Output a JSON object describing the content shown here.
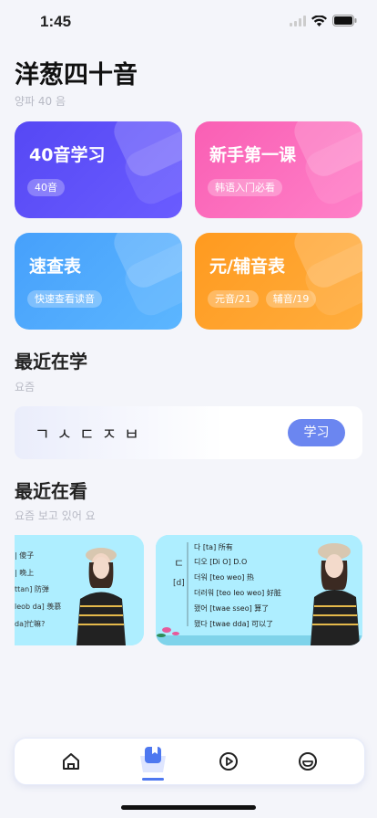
{
  "status": {
    "time": "1:45"
  },
  "header": {
    "title": "洋葱四十音",
    "subtitle": "양파 40 음"
  },
  "cards": [
    {
      "title": "40音学习",
      "tags": [
        "40音"
      ],
      "color": "#5a4bf5"
    },
    {
      "title": "新手第一课",
      "tags": [
        "韩语入门必看"
      ],
      "color": "#fb6bbd"
    },
    {
      "title": "速查表",
      "tags": [
        "快速查看读音"
      ],
      "color": "#4ea9ff"
    },
    {
      "title": "元/辅音表",
      "tags": [
        "元音/21",
        "辅音/19"
      ],
      "color": "#ffa12c"
    }
  ],
  "recent_learn": {
    "title": "最近在学",
    "subtitle": "요즘",
    "letters": "ㄱㅅㄷㅈㅂ",
    "button": "学习"
  },
  "recent_watch": {
    "title": "最近在看",
    "subtitle": "요즘 보고 있어 요",
    "videos": [
      {
        "lines": [
          "| 傻子",
          "| 晚上",
          "ttan] 防弹",
          "leob da] 羡慕",
          "da]忙嘛?"
        ]
      },
      {
        "side_char": "ㄷ",
        "side_ipa": "[d]",
        "lines": [
          "다 [ta] 所有",
          "디오 [Di O] D.O",
          "더워 [teo weo] 热",
          "더러워 [teo leo weo] 好脏",
          "됐어 [twae sseo] 算了",
          "됐다 [twae dda] 可以了"
        ]
      }
    ]
  },
  "tabbar": {
    "items": [
      "home-icon",
      "book-icon",
      "play-icon",
      "smile-icon"
    ],
    "active": 1
  }
}
